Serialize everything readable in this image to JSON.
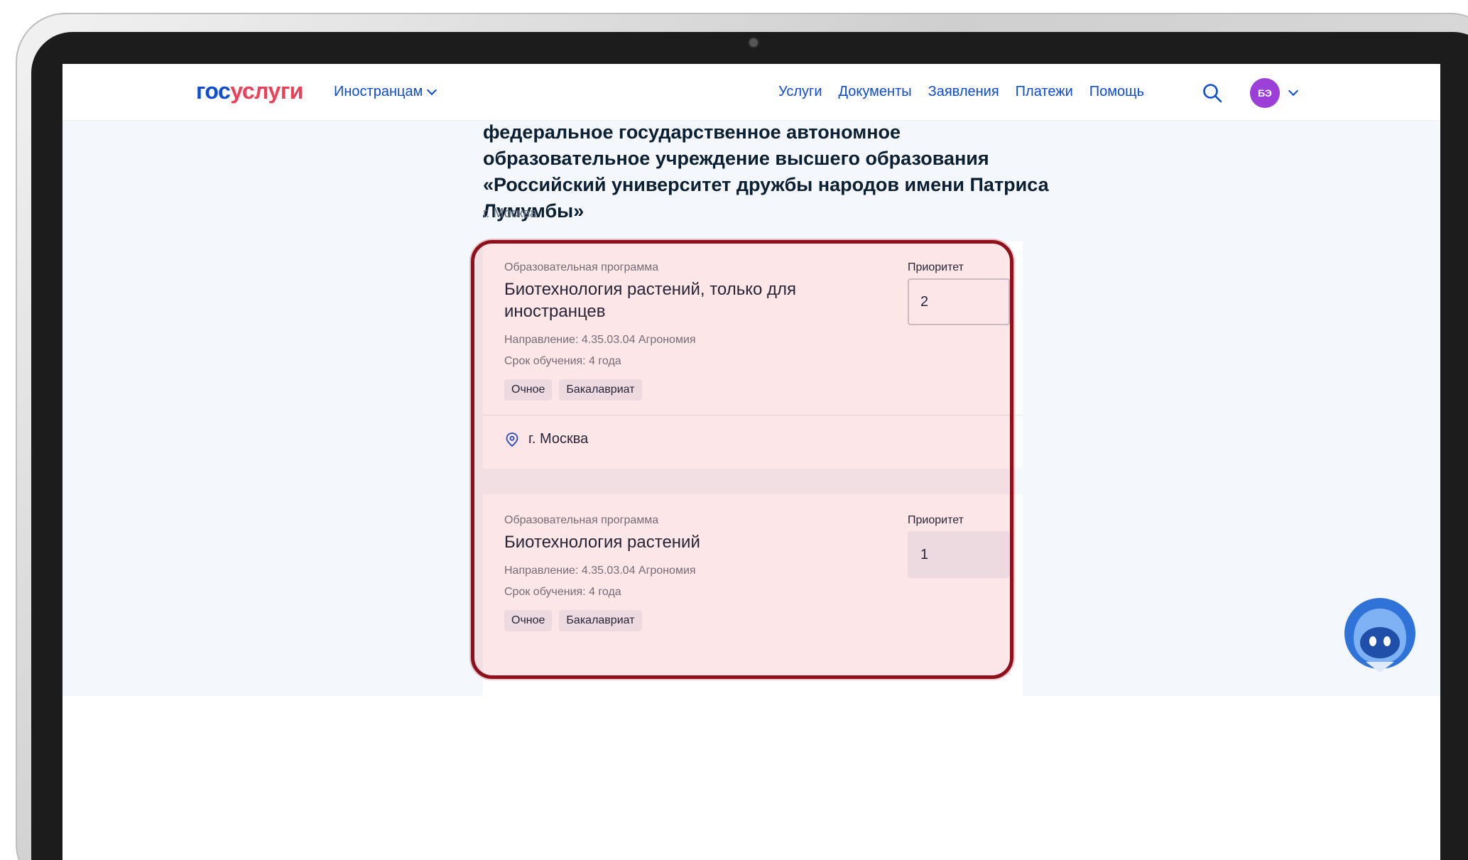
{
  "header": {
    "logo_part1": "гос",
    "logo_part2": "услуги",
    "foreigners_menu": "Иностранцам",
    "nav": [
      "Услуги",
      "Документы",
      "Заявления",
      "Платежи",
      "Помощь"
    ],
    "avatar_initials": "БЭ"
  },
  "organization": {
    "title": "федеральное государственное автономное образовательное учреждение высшего образования «Российский университет дружбы народов имени Патриса Лумумбы»",
    "city": "г. Москва"
  },
  "programs": [
    {
      "label": "Образовательная программа",
      "name": "Биотехнология растений, только для иностранцев",
      "direction": "Направление: 4.35.03.04 Агрономия",
      "duration": "Срок обучения: 4 года",
      "tags": [
        "Очное",
        "Бакалавриат"
      ],
      "priority_label": "Приоритет",
      "priority_value": "2",
      "location": "г. Москва"
    },
    {
      "label": "Образовательная программа",
      "name": "Биотехнология растений",
      "direction": "Направление: 4.35.03.04 Агрономия",
      "duration": "Срок обучения: 4 года",
      "tags": [
        "Очное",
        "Бакалавриат"
      ],
      "priority_label": "Приоритет",
      "priority_value": "1"
    }
  ],
  "colors": {
    "brand_blue": "#0d4cd3",
    "brand_red": "#ee3f58",
    "highlight_border": "#8f0f1a",
    "avatar_bg": "#9b3fd8"
  },
  "icons": [
    "search-icon",
    "chevron-down-icon",
    "location-pin-icon",
    "assistant-robot-icon"
  ]
}
